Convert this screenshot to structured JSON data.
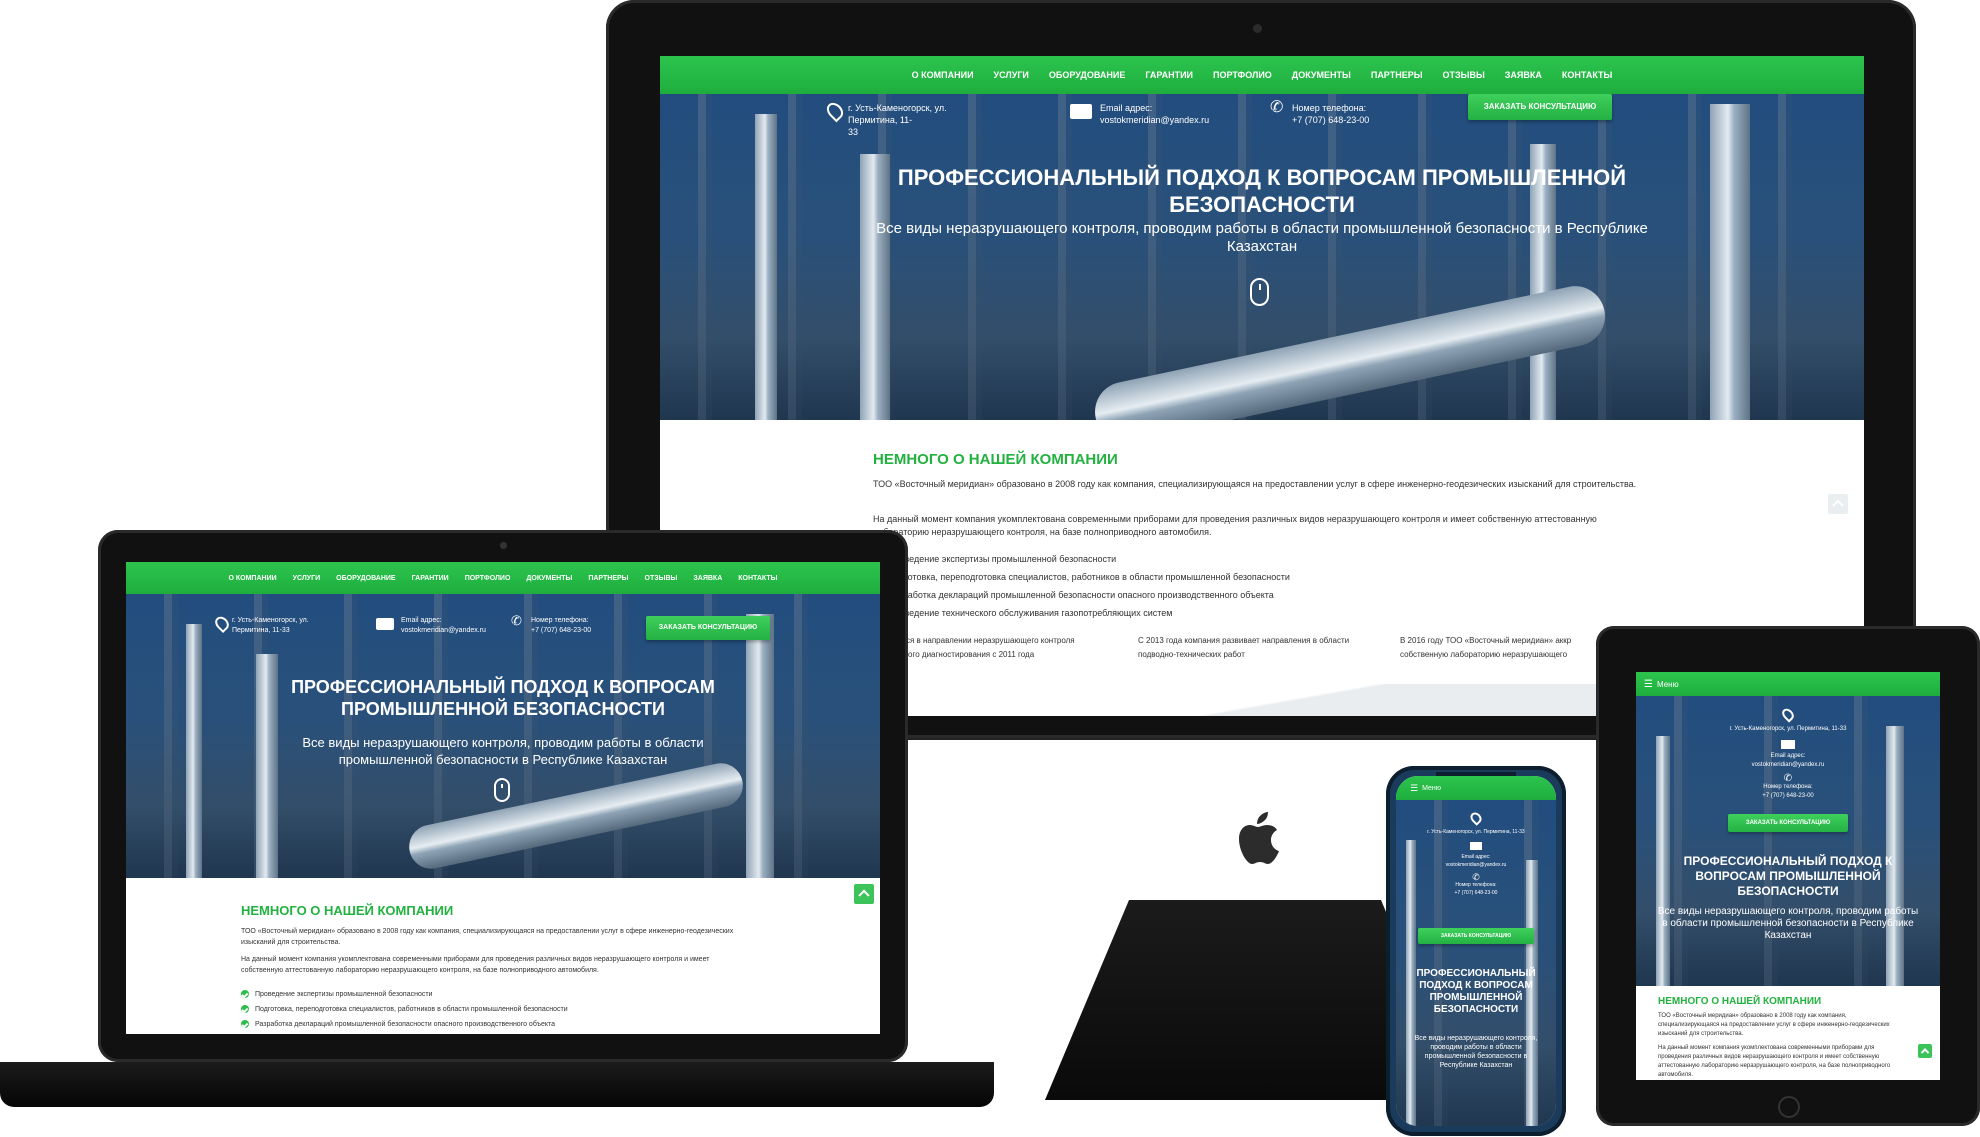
{
  "nav": {
    "items": [
      "О КОМПАНИИ",
      "УСЛУГИ",
      "ОБОРУДОВАНИЕ",
      "ГАРАНТИИ",
      "ПОРТФОЛИО",
      "ДОКУМЕНТЫ",
      "ПАРТНЕРЫ",
      "ОТЗЫВЫ",
      "ЗАЯВКА",
      "КОНТАКТЫ"
    ],
    "mobile_menu": "Меню"
  },
  "contacts": {
    "address_line1": "г. Усть-Каменогорск, ул. Пермитина, 11-",
    "address_line2": "33",
    "address_full": "г. Усть-Каменогорск, ул. Пермитина, 11-33",
    "email_label": "Email адрес:",
    "email": "vostokmeridian@yandex.ru",
    "phone_label": "Номер телефона:",
    "phone": "+7 (707) 648-23-00"
  },
  "cta": "ЗАКАЗАТЬ КОНСУЛЬТАЦИЮ",
  "hero": {
    "title": "ПРОФЕССИОНАЛЬНЫЙ ПОДХОД К ВОПРОСАМ ПРОМЫШЛЕННОЙ БЕЗОПАСНОСТИ",
    "subtitle": "Все виды неразрушающего контроля, проводим работы в области промышленной безопасности в Республике Казахстан"
  },
  "about": {
    "title": "НЕМНОГО О НАШЕЙ КОМПАНИИ",
    "p1": "ТОО «Восточный меридиан» образовано в 2008 году как компания, специализирующаяся на предоставлении услуг в сфере инженерно-геодезических изысканий для строительства.",
    "p2": "На данный момент компания укомплектована современными приборами для проведения различных видов неразрушающего контроля и имеет собственную аттестованную лабораторию неразрушающего контроля, на базе полноприводного автомобиля.",
    "list": [
      "Проведение экспертизы промышленной безопасности",
      "Подготовка, переподготовка специалистов, работников в области промышленной безопасности",
      "Разработка деклараций промышленной безопасности опасного производственного объекта",
      "Проведение технического обслуживания газопотребляющих систем"
    ],
    "facts_desktop": [
      "емся в направлении неразрушающего контроля",
      "еского диагностирования с 2011 года",
      "С 2013 года компания развивает направления в области",
      "подводно-технических работ",
      "В 2016 году ТОО «Восточный меридиан» аккр",
      "собственную лабораторию неразрушающего"
    ]
  }
}
